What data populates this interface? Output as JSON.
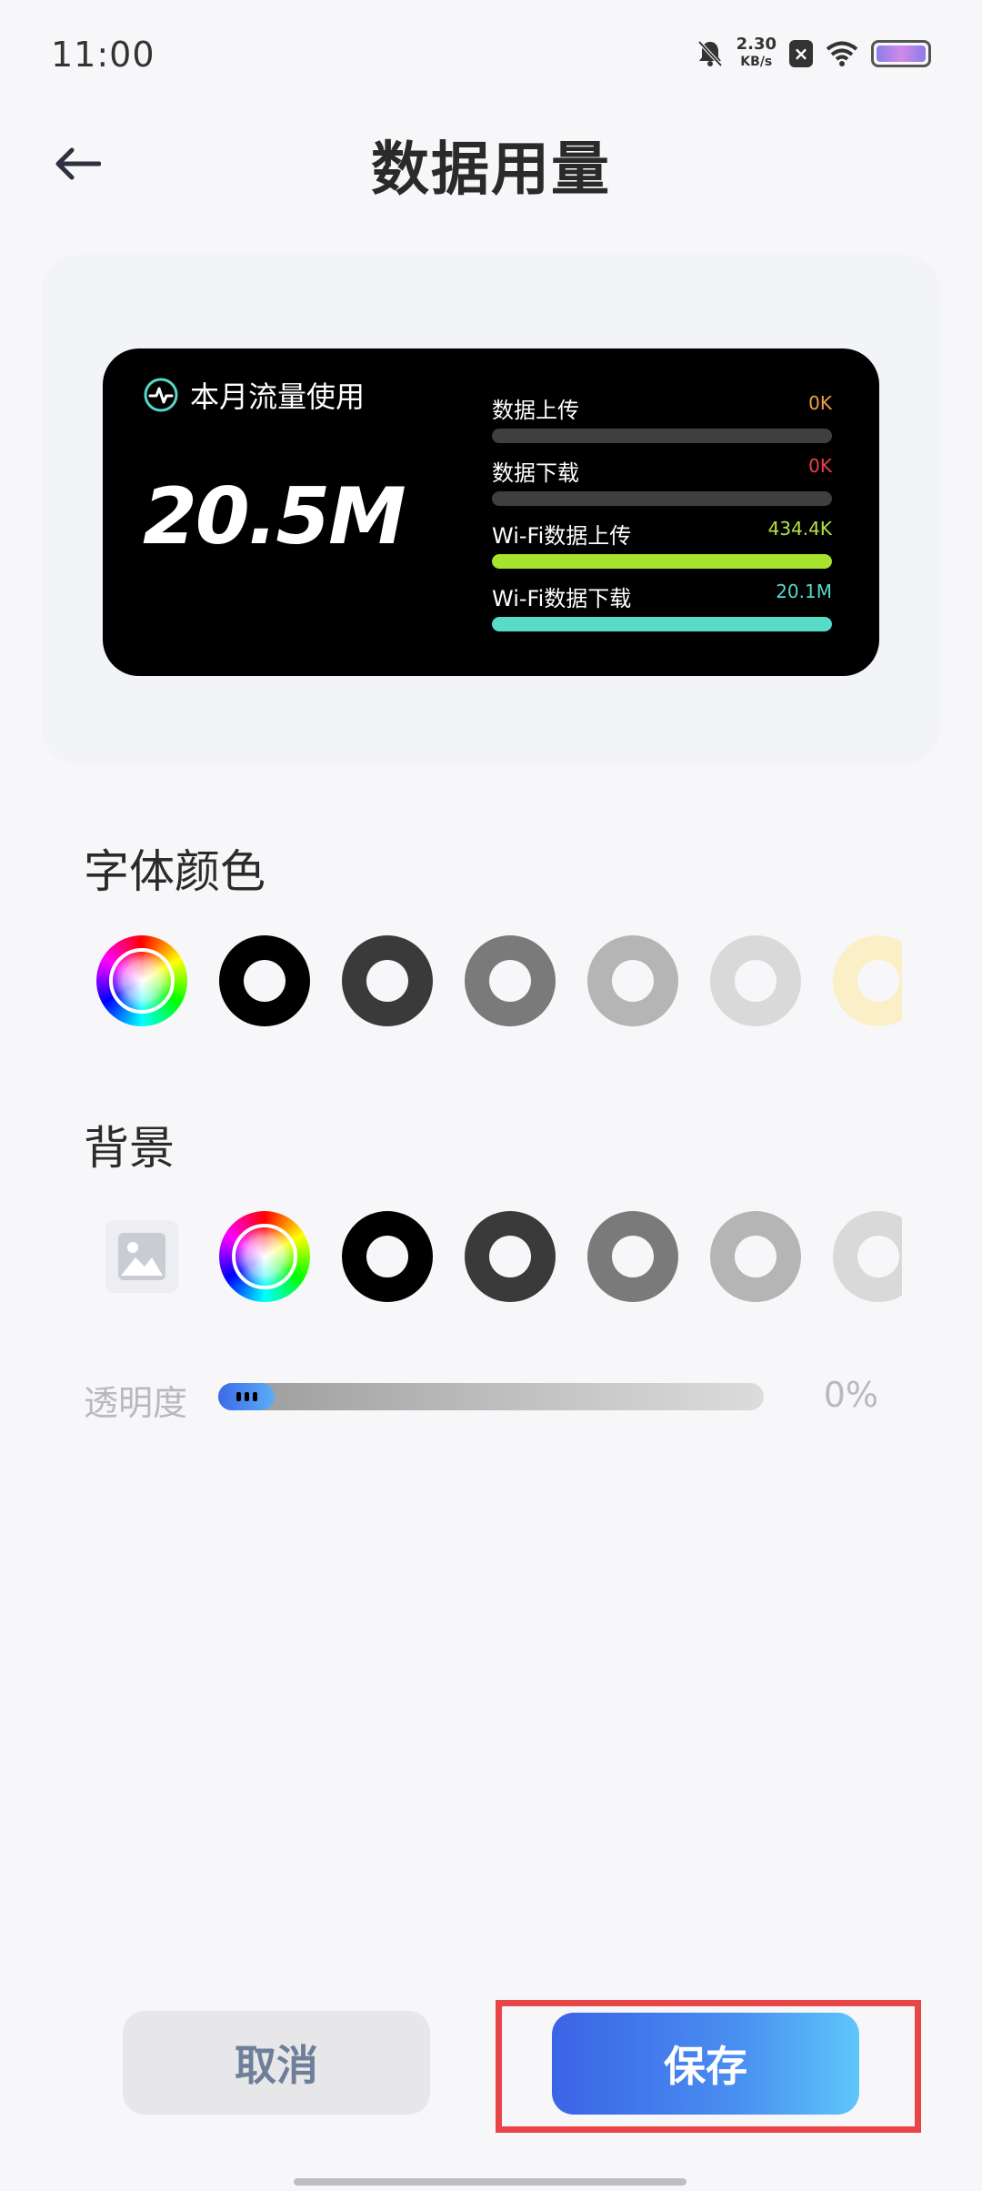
{
  "status_bar": {
    "time": "11:00",
    "speed_value": "2.30",
    "speed_unit": "KB/s",
    "icons": [
      "mute-bell-icon",
      "x-box-icon",
      "wifi-icon",
      "battery-icon"
    ],
    "battery_color": "#b48ae8"
  },
  "header": {
    "title": "数据用量",
    "back_icon": "arrow-left-icon"
  },
  "widget": {
    "title": "本月流量使用",
    "pulse_icon": "activity-icon",
    "total": "20.5M",
    "items": [
      {
        "label": "数据上传",
        "value": "0K",
        "value_color": "#f0a040",
        "fill_color": "#3f3f3f",
        "fill_fraction": 0
      },
      {
        "label": "数据下载",
        "value": "0K",
        "value_color": "#e8404a",
        "fill_color": "#3f3f3f",
        "fill_fraction": 0
      },
      {
        "label": "Wi-Fi数据上传",
        "value": "434.4K",
        "value_color": "#b8e040",
        "fill_color": "#a6e22e",
        "fill_fraction": 1
      },
      {
        "label": "Wi-Fi数据下载",
        "value": "20.1M",
        "value_color": "#56d8c8",
        "fill_color": "#56dcc8",
        "fill_fraction": 1
      }
    ]
  },
  "font_color": {
    "title": "字体颜色",
    "swatches": [
      {
        "type": "rainbow"
      },
      {
        "type": "ring",
        "color": "#000000"
      },
      {
        "type": "ring",
        "color": "#3a3a3a"
      },
      {
        "type": "ring",
        "color": "#7a7a7a"
      },
      {
        "type": "ring",
        "color": "#b5b5b5"
      },
      {
        "type": "ring",
        "color": "#d9d9d9"
      },
      {
        "type": "ring",
        "color": "#fbefc8"
      }
    ]
  },
  "background": {
    "title": "背景",
    "image_icon": "image-icon",
    "swatches": [
      {
        "type": "rainbow"
      },
      {
        "type": "ring",
        "color": "#000000"
      },
      {
        "type": "ring",
        "color": "#3a3a3a"
      },
      {
        "type": "ring",
        "color": "#7a7a7a"
      },
      {
        "type": "ring",
        "color": "#b5b5b5"
      },
      {
        "type": "ring",
        "color": "#d9d9d9"
      }
    ]
  },
  "opacity": {
    "label": "透明度",
    "value": "0%"
  },
  "buttons": {
    "cancel": "取消",
    "save": "保存"
  }
}
